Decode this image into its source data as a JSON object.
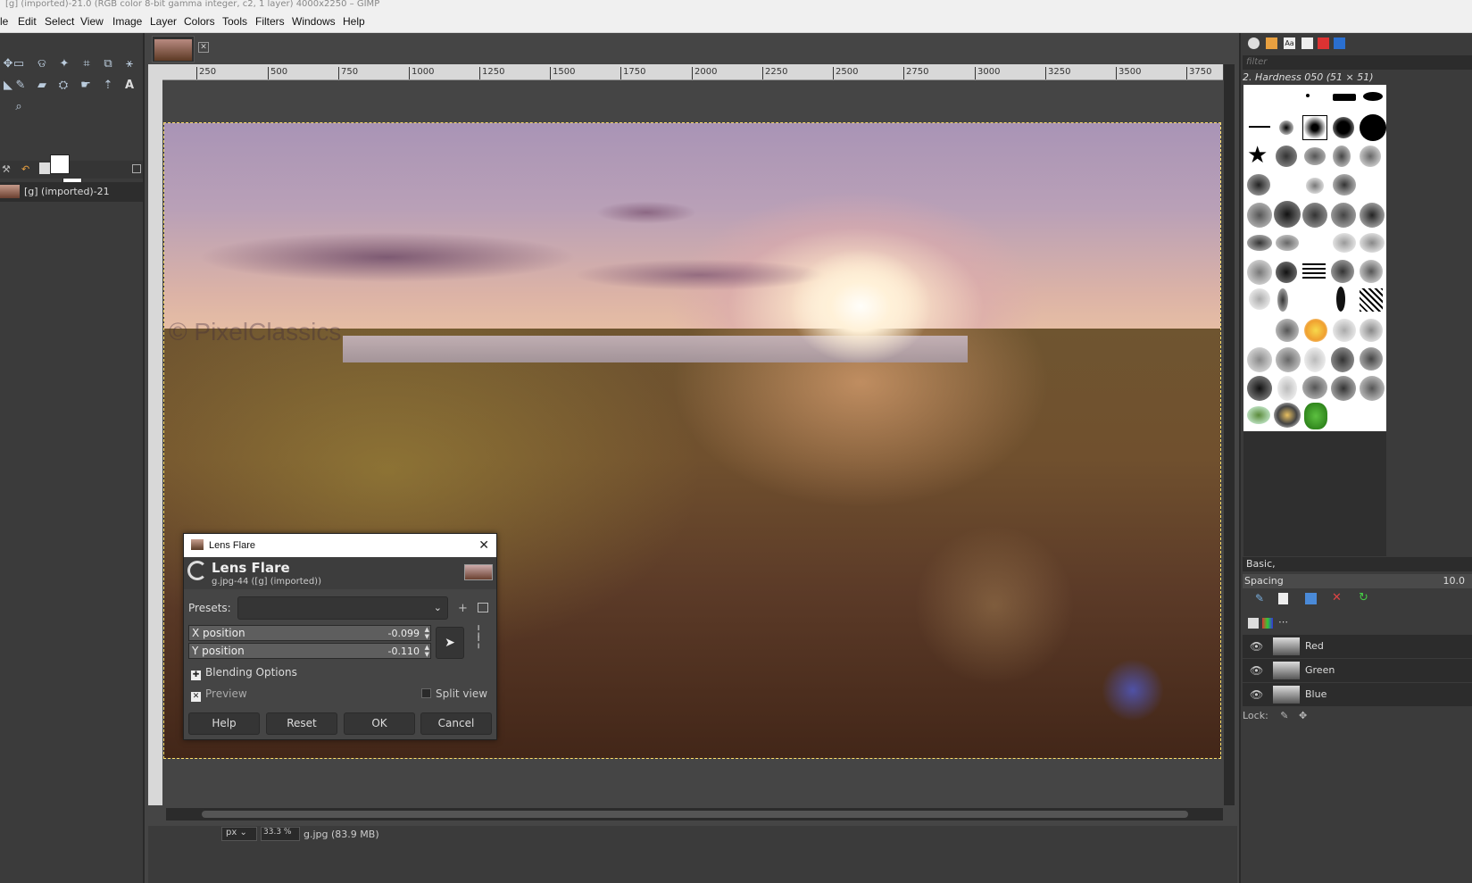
{
  "window": {
    "title": "[g] (imported)-21.0 (RGB color 8-bit gamma integer, c2, 1 layer) 4000x2250 – GIMP"
  },
  "menubar": [
    "File",
    "Edit",
    "Select",
    "View",
    "Image",
    "Layer",
    "Colors",
    "Tools",
    "Filters",
    "Windows",
    "Help"
  ],
  "menubar_visible": [
    "le",
    "Edit",
    "Select",
    "View",
    "Image",
    "Layer",
    "Colors",
    "Tools",
    "Filters",
    "Windows",
    "Help"
  ],
  "images_panel": {
    "item_label": "[g] (imported)-21"
  },
  "ruler": {
    "ticks": [
      "250",
      "500",
      "750",
      "1000",
      "1250",
      "1500",
      "1750",
      "2000",
      "2250",
      "2500",
      "2750",
      "3000",
      "3250",
      "3500",
      "3750"
    ]
  },
  "canvas": {
    "watermark": "© PixelClassics"
  },
  "statusbar": {
    "unit": "px",
    "zoom": "33.3 %",
    "text": "g.jpg (83.9 MB)"
  },
  "brushes": {
    "filter_placeholder": "filter",
    "selected_name": "2. Hardness 050 (51 × 51)",
    "preset": "Basic,",
    "spacing_label": "Spacing",
    "spacing_value": "10.0"
  },
  "channels": [
    {
      "label": "Red"
    },
    {
      "label": "Green"
    },
    {
      "label": "Blue"
    }
  ],
  "lock_label": "Lock:",
  "dialog": {
    "window_title": "Lens Flare",
    "heading": "Lens Flare",
    "subheading": "g.jpg-44 ([g] (imported))",
    "presets_label": "Presets:",
    "presets_value": "",
    "x_label": "X position",
    "x_value": "-0.099",
    "y_label": "Y position",
    "y_value": "-0.110",
    "blending_label": "Blending Options",
    "preview_label": "Preview",
    "preview_checked": true,
    "split_label": "Split view",
    "split_checked": false,
    "buttons": {
      "help": "Help",
      "reset": "Reset",
      "ok": "OK",
      "cancel": "Cancel"
    }
  },
  "colors": {
    "accent": "#ffde6a",
    "panel": "#3b3b3b",
    "canvas_bg": "#454545"
  }
}
